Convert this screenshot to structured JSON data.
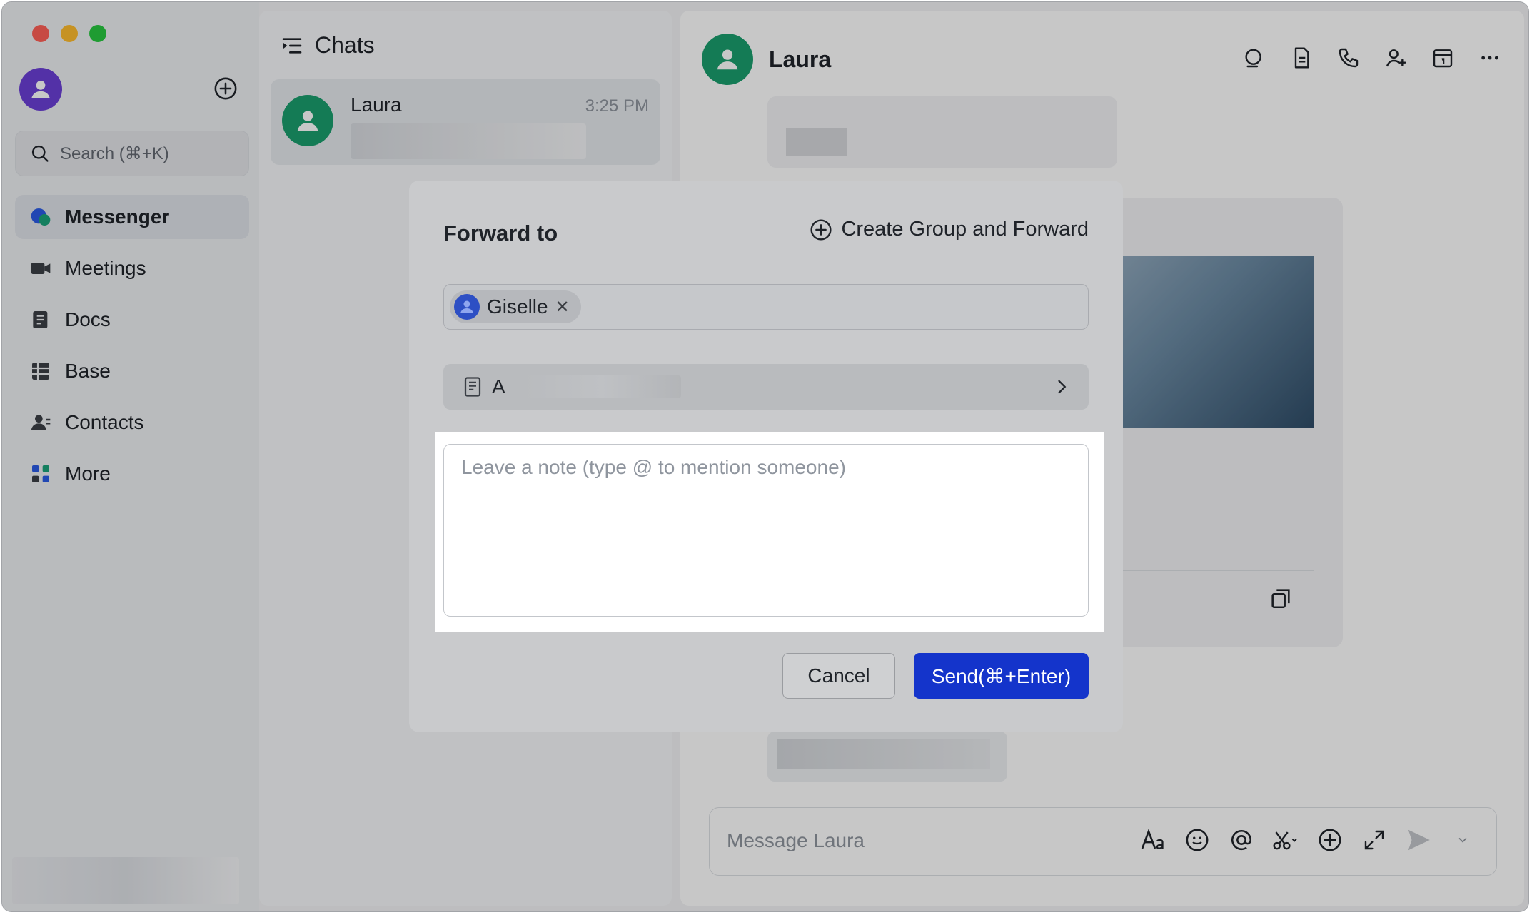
{
  "sidebar": {
    "search_placeholder": "Search (⌘+K)",
    "items": [
      {
        "label": "Messenger",
        "active": true
      },
      {
        "label": "Meetings"
      },
      {
        "label": "Docs"
      },
      {
        "label": "Base"
      },
      {
        "label": "Contacts"
      },
      {
        "label": "More"
      }
    ]
  },
  "chatlist": {
    "title": "Chats",
    "chats": [
      {
        "name": "Laura",
        "time": "3:25 PM"
      }
    ]
  },
  "conversation": {
    "name": "Laura",
    "composer_placeholder": "Message Laura"
  },
  "modal": {
    "title": "Forward to",
    "create_group_label": "Create Group and Forward",
    "recipients": [
      {
        "name": "Giselle",
        "remove_glyph": "✕"
      }
    ],
    "preview_label": "A",
    "note_placeholder": "Leave a note (type @ to mention someone)",
    "cancel_label": "Cancel",
    "send_label": "Send(⌘+Enter)"
  },
  "colors": {
    "accent": "#1434cb",
    "avatar_green": "#1a9e6d",
    "avatar_purple": "#6b3fd6",
    "chip_avatar": "#2d4fc4"
  }
}
